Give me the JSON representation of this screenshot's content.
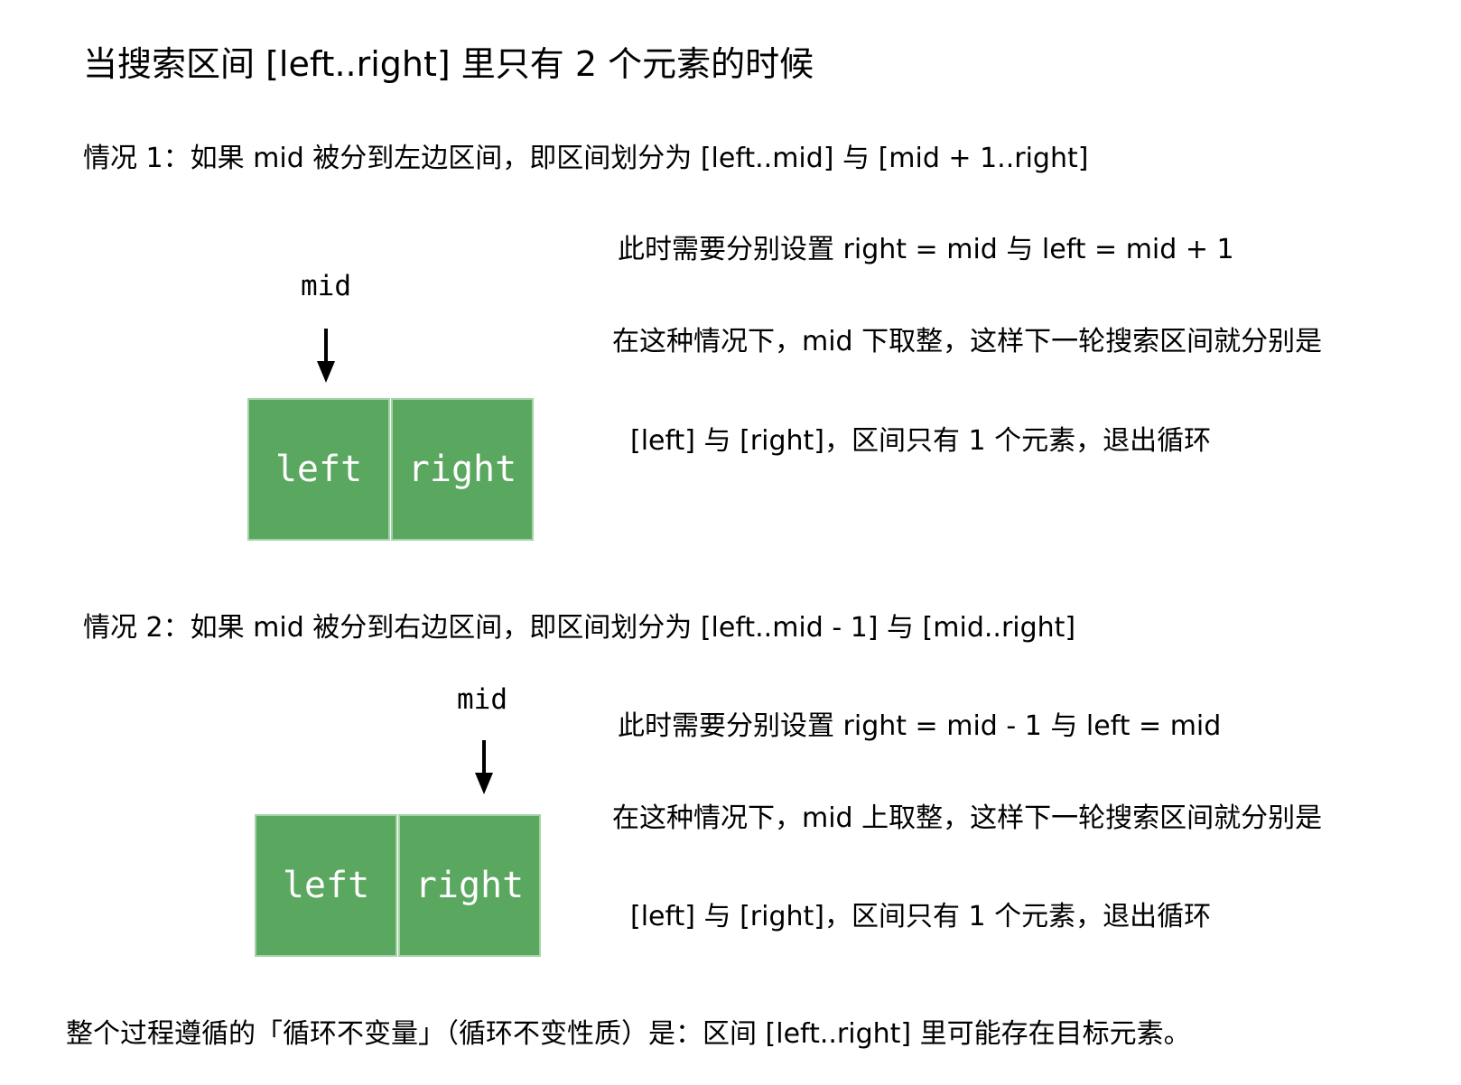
{
  "title": "当搜索区间 [left..right] 里只有 2 个元素的时候",
  "case1": {
    "heading": "情况 1：如果 mid 被分到左边区间，即区间划分为 [left..mid] 与 [mid + 1..right]",
    "mid_label": "mid",
    "cells": [
      "left",
      "right"
    ],
    "mid_points_to": "left",
    "lines": [
      "此时需要分别设置 right = mid 与 left = mid + 1",
      "在这种情况下，mid 下取整，这样下一轮搜索区间就分别是",
      "[left] 与 [right]，区间只有 1 个元素，退出循环"
    ]
  },
  "case2": {
    "heading": "情况 2：如果 mid 被分到右边区间，即区间划分为 [left..mid - 1] 与 [mid..right]",
    "mid_label": "mid",
    "cells": [
      "left",
      "right"
    ],
    "mid_points_to": "right",
    "lines": [
      "此时需要分别设置 right = mid - 1 与 left = mid",
      "在这种情况下，mid 上取整，这样下一轮搜索区间就分别是",
      "[left] 与 [right]，区间只有 1 个元素，退出循环"
    ]
  },
  "footer": "整个过程遵循的「循环不变量」（循环不变性质）是：区间 [left..right] 里可能存在目标元素。",
  "colors": {
    "cell_fill": "#5aa75f",
    "cell_border": "#a3d3a6",
    "cell_text": "#ffffff",
    "text": "#000000"
  }
}
